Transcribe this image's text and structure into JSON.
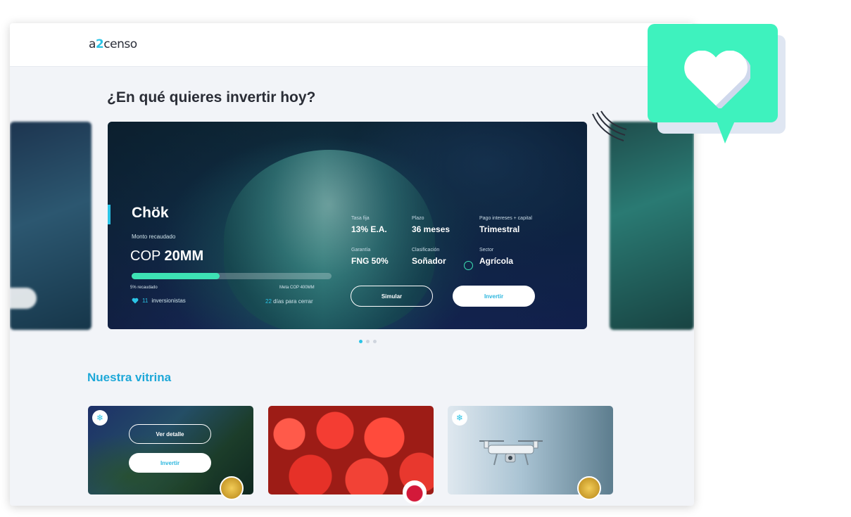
{
  "app": {
    "logo_prefix": "a",
    "logo_accent": "2",
    "logo_suffix": "censo"
  },
  "hero": {
    "heading": "¿En qué quieres invertir hoy?"
  },
  "featured": {
    "name": "Chök",
    "raised_label": "Monto recaudado",
    "raised_currency": "COP",
    "raised_amount": "20MM",
    "progress": 0.44,
    "percent_label": "5% recaudado",
    "goal_label": "Meta COP 400MM",
    "investors_count": "11",
    "investors_label": "inversionistas",
    "days_count": "22",
    "days_label": "días para cerrar",
    "facts": {
      "tasa_label": "Tasa fija",
      "tasa_value": "13% E.A.",
      "plazo_label": "Plazo",
      "plazo_value": "36 meses",
      "pago_label": "Pago intereses + capital",
      "pago_value": "Trimestral",
      "garantia_label": "Garantía",
      "garantia_value": "FNG 50%",
      "clasif_label": "Clasificación",
      "clasif_value": "Soñador",
      "sector_label": "Sector",
      "sector_value": "Agrícola"
    },
    "simulate_button": "Simular",
    "invest_button": "Invertir"
  },
  "carousel": {
    "slides": 3,
    "active_index": 0
  },
  "vitrina": {
    "title": "Nuestra vitrina",
    "detail_button": "Ver detalle",
    "invest_button": "Invertir"
  },
  "colors": {
    "accent": "#2bc4e6",
    "progress": "#3de2b4",
    "bubble": "#3ef2be",
    "title_blue": "#1ea8d8"
  },
  "icons": {
    "investors": "heart-icon",
    "classification": "circle-icon",
    "notification": "heart-icon",
    "thumb_badge": "snowflake-icon"
  }
}
